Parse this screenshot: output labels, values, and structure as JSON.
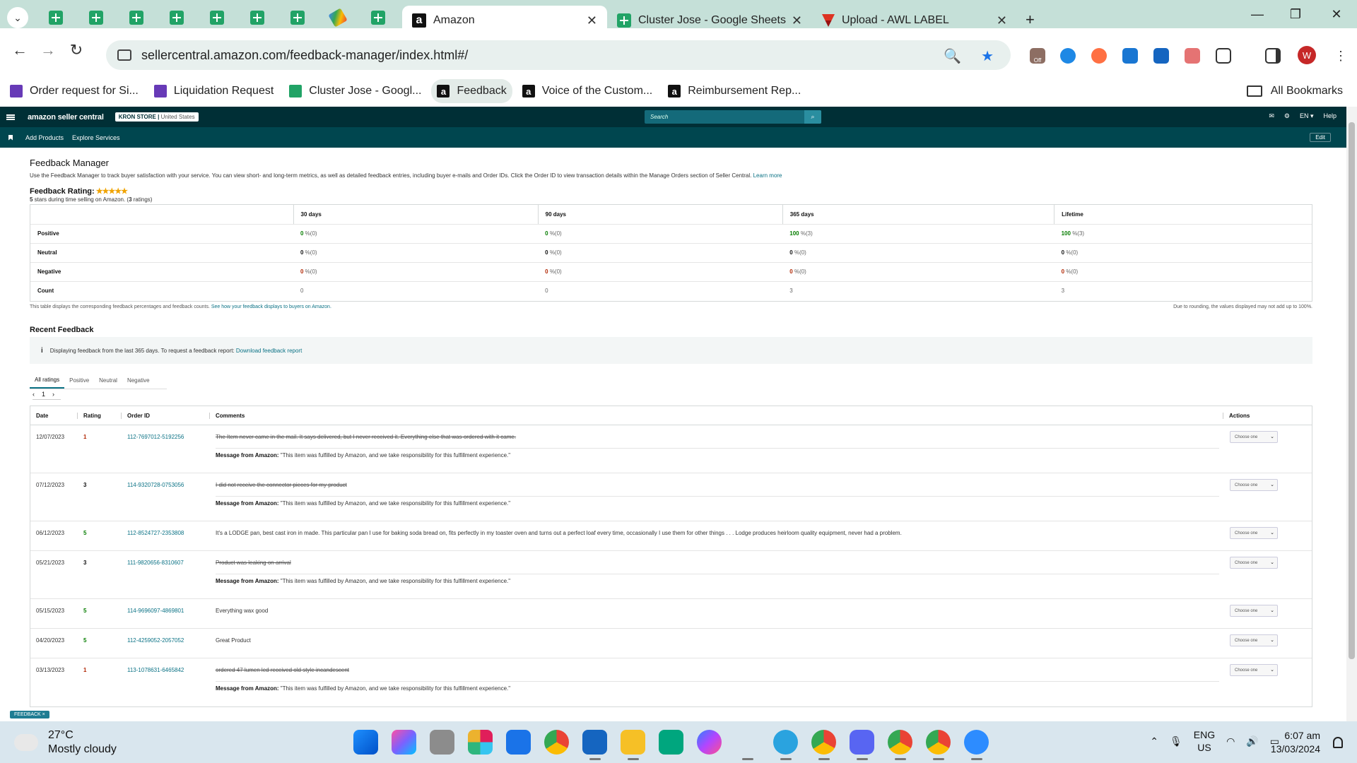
{
  "browser": {
    "tabs": [
      {
        "title": "Amazon",
        "active": true
      },
      {
        "title": "Cluster Jose - Google Sheets",
        "active": false
      },
      {
        "title": "Upload - AWL LABEL",
        "active": false
      }
    ],
    "new_tab": "+",
    "url": "sellercentral.amazon.com/feedback-manager/index.html#/",
    "bookmarks": [
      {
        "label": "Order request for Si...",
        "icon": "form-icon"
      },
      {
        "label": "Liquidation Request",
        "icon": "form-icon"
      },
      {
        "label": "Cluster Jose - Googl...",
        "icon": "sheets-icon"
      },
      {
        "label": "Feedback",
        "icon": "amazon-icon"
      },
      {
        "label": "Voice of the Custom...",
        "icon": "amazon-icon"
      },
      {
        "label": "Reimbursement Rep...",
        "icon": "amazon-icon"
      }
    ],
    "all_bookmarks": "All Bookmarks",
    "profile_initial": "W",
    "ext_off_label": "Off"
  },
  "seller_central": {
    "logo": "amazon seller central",
    "store": "KRON STORE",
    "country": "United States",
    "search_placeholder": "Search",
    "lang": "EN",
    "help": "Help",
    "sub_nav": [
      "Add Products",
      "Explore Services"
    ],
    "edit": "Edit"
  },
  "page": {
    "title": "Feedback Manager",
    "description": "Use the Feedback Manager to track buyer satisfaction with your service. You can view short- and long-term metrics, as well as detailed feedback entries, including buyer e-mails and Order IDs. Click the Order ID to view transaction details within the Manage Orders section of Seller Central.",
    "learn_more": "Learn more",
    "rating_label": "Feedback Rating:",
    "stars": "★★★★★",
    "rating_stars_num": "5",
    "rating_mid": " stars during time selling on Amazon. (",
    "rating_count": "3",
    "rating_end": " ratings)"
  },
  "metrics": {
    "columns": [
      "30 days",
      "90 days",
      "365 days",
      "Lifetime"
    ],
    "rows": [
      {
        "label": "Positive",
        "cells": [
          [
            "0",
            " %(0)"
          ],
          [
            "0",
            " %(0)"
          ],
          [
            "100",
            " %(3)"
          ],
          [
            "100",
            " %(3)"
          ]
        ]
      },
      {
        "label": "Neutral",
        "cells": [
          [
            "0",
            " %(0)"
          ],
          [
            "0",
            " %(0)"
          ],
          [
            "0",
            " %(0)"
          ],
          [
            "0",
            " %(0)"
          ]
        ]
      },
      {
        "label": "Negative",
        "cells": [
          [
            "0",
            " %(0)"
          ],
          [
            "0",
            " %(0)"
          ],
          [
            "0",
            " %(0)"
          ],
          [
            "0",
            " %(0)"
          ]
        ]
      },
      {
        "label": "Count",
        "cells": [
          [
            "",
            "0"
          ],
          [
            "",
            "0"
          ],
          [
            "",
            "3"
          ],
          [
            "",
            "3"
          ]
        ]
      }
    ],
    "note_left": "This table displays the corresponding feedback percentages and feedback counts.",
    "note_left_link": "See how your feedback displays to buyers on Amazon.",
    "note_right": "Due to rounding, the values displayed may not add up to 100%."
  },
  "recent": {
    "title": "Recent Feedback",
    "info": "Displaying feedback from the last 365 days. To request a feedback report:",
    "info_link": "Download feedback report",
    "filters": [
      "All ratings",
      "Positive",
      "Neutral",
      "Negative"
    ],
    "page": "1",
    "headers": [
      "Date",
      "Rating",
      "Order ID",
      "Comments",
      "Actions"
    ],
    "message_label": "Message from Amazon:",
    "message_text": " \"This item was fulfilled by Amazon, and we take responsibility for this fulfillment experience.\"",
    "choose": "Choose one",
    "rows": [
      {
        "date": "12/07/2023",
        "rating": "1",
        "order": "112-7697012-5192256",
        "comment": "The Item never came in the mail. It says delivered, but I never received it. Everything else that was ordered with it came.",
        "struck": true
      },
      {
        "date": "07/12/2023",
        "rating": "3",
        "order": "114-9320728-0753056",
        "comment": "I did not receive the connector pieces for my product",
        "struck": true
      },
      {
        "date": "06/12/2023",
        "rating": "5",
        "order": "112-8524727-2353808",
        "comment": "It's a LODGE pan, best cast iron in made. This particular pan I use for baking soda bread on, fits perfectly in my toaster oven and turns out a perfect loaf every time, occasionally I use them for other things . . . Lodge produces heirloom quality equipment, never had a problem.",
        "struck": false
      },
      {
        "date": "05/21/2023",
        "rating": "3",
        "order": "111-9820656-8310607",
        "comment": "Product was leaking on arrival",
        "struck": true
      },
      {
        "date": "05/15/2023",
        "rating": "5",
        "order": "114-9696097-4869801",
        "comment": "Everything wax good",
        "struck": false
      },
      {
        "date": "04/20/2023",
        "rating": "5",
        "order": "112-4259052-2057052",
        "comment": "Great Product",
        "struck": false
      },
      {
        "date": "03/13/2023",
        "rating": "1",
        "order": "113-1078631-6465842",
        "comment": "ordered 47 lumen led received old style incandescent",
        "struck": true
      }
    ]
  },
  "feedback_tag": "FEEDBACK ×",
  "taskbar": {
    "temp": "27°C",
    "weather": "Mostly cloudy",
    "lang1": "ENG",
    "lang2": "US",
    "time": "6:07 am",
    "date": "13/03/2024"
  },
  "colors": {
    "topnav": "#002f36",
    "subnav": "#00464f",
    "positive": "#067d00",
    "negative": "#b12704",
    "link": "#0b7285"
  }
}
